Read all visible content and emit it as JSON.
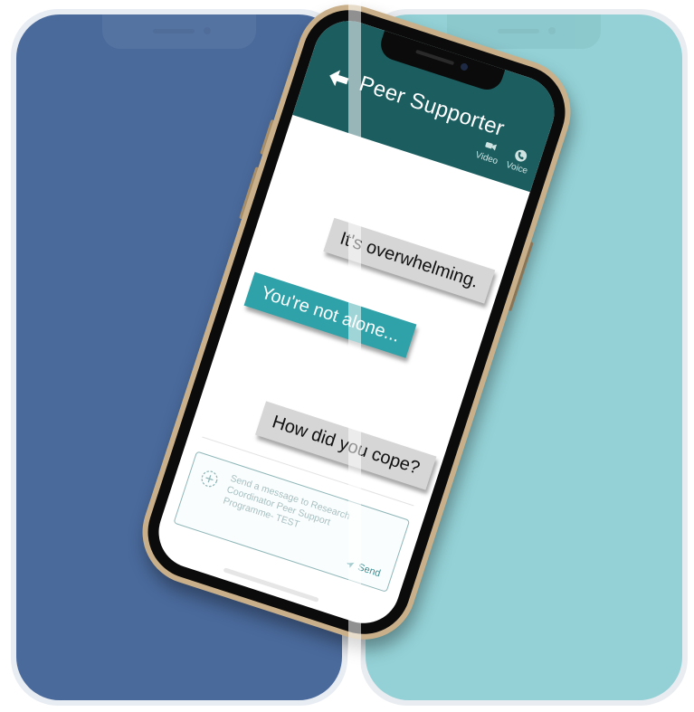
{
  "header": {
    "title": "Peer Supporter",
    "video_label": "Video",
    "voice_label": "Voice"
  },
  "messages": [
    {
      "text": "It's overwhelming.",
      "side": "incoming"
    },
    {
      "text": "You're not alone...",
      "side": "outgoing"
    },
    {
      "text": "How did you cope?",
      "side": "incoming"
    }
  ],
  "composer": {
    "placeholder": "Send a message to Research Coordinator Peer Support Programme- TEST",
    "send_label": "Send"
  },
  "colors": {
    "left_panel": "#4a6a9c",
    "right_panel": "#93d1d6",
    "header": "#1c5e60",
    "outgoing_bubble": "#2ea2a8",
    "incoming_bubble": "#d6d6d6",
    "phone_frame": "#c9b08a"
  },
  "icons": [
    "back-arrow-icon",
    "video-icon",
    "phone-icon",
    "add-icon",
    "send-icon"
  ]
}
